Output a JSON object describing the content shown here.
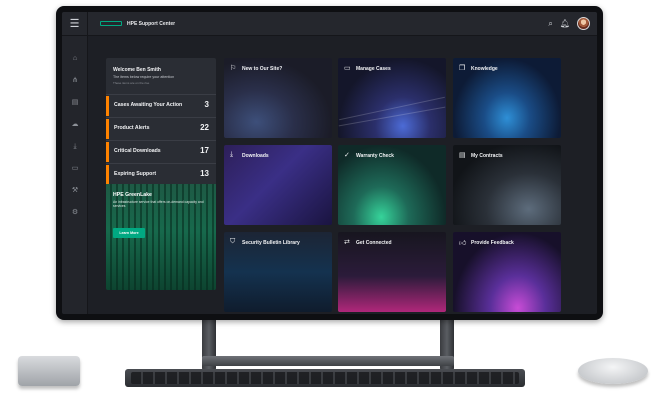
{
  "app": {
    "title": "HPE Support Center"
  },
  "topbar": {
    "menu_icon": "menu-icon",
    "search_icon": "search-icon",
    "bell_icon": "bell-icon"
  },
  "rail": {
    "icons": [
      "home-icon",
      "network-icon",
      "chart-icon",
      "cloud-icon",
      "download-icon",
      "monitor-icon",
      "tools-icon",
      "settings-icon"
    ]
  },
  "welcome": {
    "greeting": "Welcome Ben Smith",
    "subtitle": "The items below require your attention",
    "note": "These items are on the rise",
    "stats": [
      {
        "label": "Cases Awaiting Your Action",
        "value": "3"
      },
      {
        "label": "Product Alerts",
        "value": "22"
      },
      {
        "label": "Critical Downloads",
        "value": "17"
      },
      {
        "label": "Expiring Support",
        "value": "13"
      }
    ],
    "promo": {
      "title": "HPE GreenLake",
      "description": "An infrastructure service that offers on-demand capacity and services",
      "button": "Learn More"
    }
  },
  "tiles": [
    {
      "label": "New to Our Site?",
      "icon": "signpost-icon"
    },
    {
      "label": "Manage Cases",
      "icon": "folder-icon"
    },
    {
      "label": "Knowledge",
      "icon": "book-icon"
    },
    {
      "label": "Downloads",
      "icon": "download-icon"
    },
    {
      "label": "Warranty Check",
      "icon": "check-badge-icon"
    },
    {
      "label": "My Contracts",
      "icon": "document-icon"
    },
    {
      "label": "Security Bulletin Library",
      "icon": "shield-icon"
    },
    {
      "label": "Get Connected",
      "icon": "connect-icon"
    },
    {
      "label": "Provide Feedback",
      "icon": "thumbs-up-icon"
    }
  ],
  "colors": {
    "accent": "#01a982",
    "alert": "#ff8300"
  }
}
